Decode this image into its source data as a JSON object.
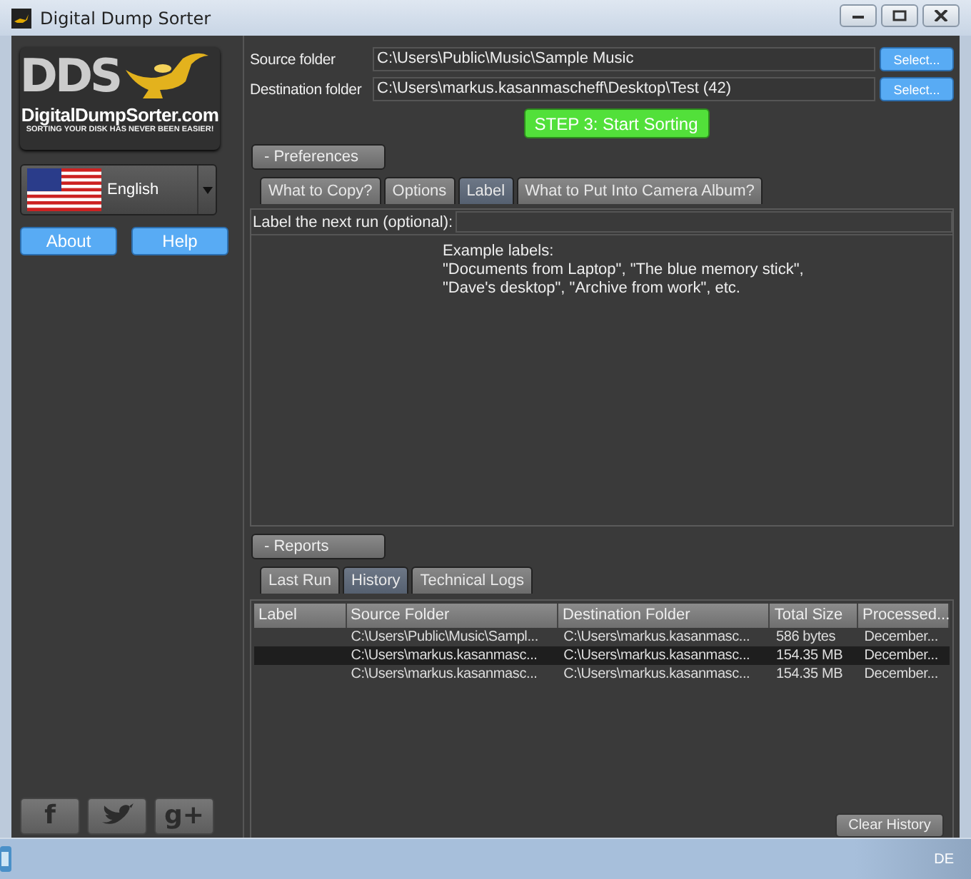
{
  "window": {
    "title": "Digital Dump Sorter"
  },
  "sidebar": {
    "logo": {
      "mark": "DDS",
      "name": "DigitalDumpSorter.com",
      "slogan": "SORTING YOUR DISK HAS NEVER BEEN EASIER!"
    },
    "language": {
      "value": "English"
    },
    "buttons": [
      "About",
      "Help"
    ],
    "social": [
      {
        "kind": "facebook",
        "glyph": "f"
      },
      {
        "kind": "twitter"
      },
      {
        "kind": "googleplus",
        "glyph": "g+"
      }
    ]
  },
  "folders": [
    {
      "label": "Source folder",
      "value": "C:\\Users\\Public\\Music\\Sample Music",
      "button": "Select..."
    },
    {
      "label": "Destination folder",
      "value": "C:\\Users\\markus.kasanmascheff\\Desktop\\Test (42)",
      "button": "Select..."
    }
  ],
  "start_button": "STEP 3: Start Sorting",
  "preferences": {
    "toggle": "- Preferences",
    "tabs": [
      {
        "label": "What to Copy?",
        "selected": false
      },
      {
        "label": "Options",
        "selected": false
      },
      {
        "label": "Label",
        "selected": true
      },
      {
        "label": "What to Put Into Camera Album?",
        "selected": false
      }
    ],
    "label_field": {
      "label": "Label the next run (optional):"
    },
    "example": [
      "Example labels:",
      "\"Documents from Laptop\", \"The blue memory stick\",",
      "\"Dave's desktop\", \"Archive from work\", etc."
    ]
  },
  "reports": {
    "toggle": "- Reports",
    "tabs": [
      {
        "label": "Last Run",
        "selected": false
      },
      {
        "label": "History",
        "selected": true
      },
      {
        "label": "Technical Logs",
        "selected": false
      }
    ],
    "table": {
      "columns": [
        "Label",
        "Source Folder",
        "Destination Folder",
        "Total Size",
        "Processed..."
      ],
      "rows": [
        {
          "cells": [
            "",
            "C:\\Users\\Public\\Music\\Sampl...",
            "C:\\Users\\markus.kasanmasc...",
            "586 bytes",
            "December..."
          ],
          "selected": false
        },
        {
          "cells": [
            "",
            "C:\\Users\\markus.kasanmasc...",
            "C:\\Users\\markus.kasanmasc...",
            "154.35 MB",
            "December..."
          ],
          "selected": true
        },
        {
          "cells": [
            "",
            "C:\\Users\\markus.kasanmasc...",
            "C:\\Users\\markus.kasanmasc...",
            "154.35 MB",
            "December..."
          ],
          "selected": false
        }
      ]
    },
    "clear_button": "Clear History"
  },
  "taskbar": {
    "language": "DE"
  }
}
